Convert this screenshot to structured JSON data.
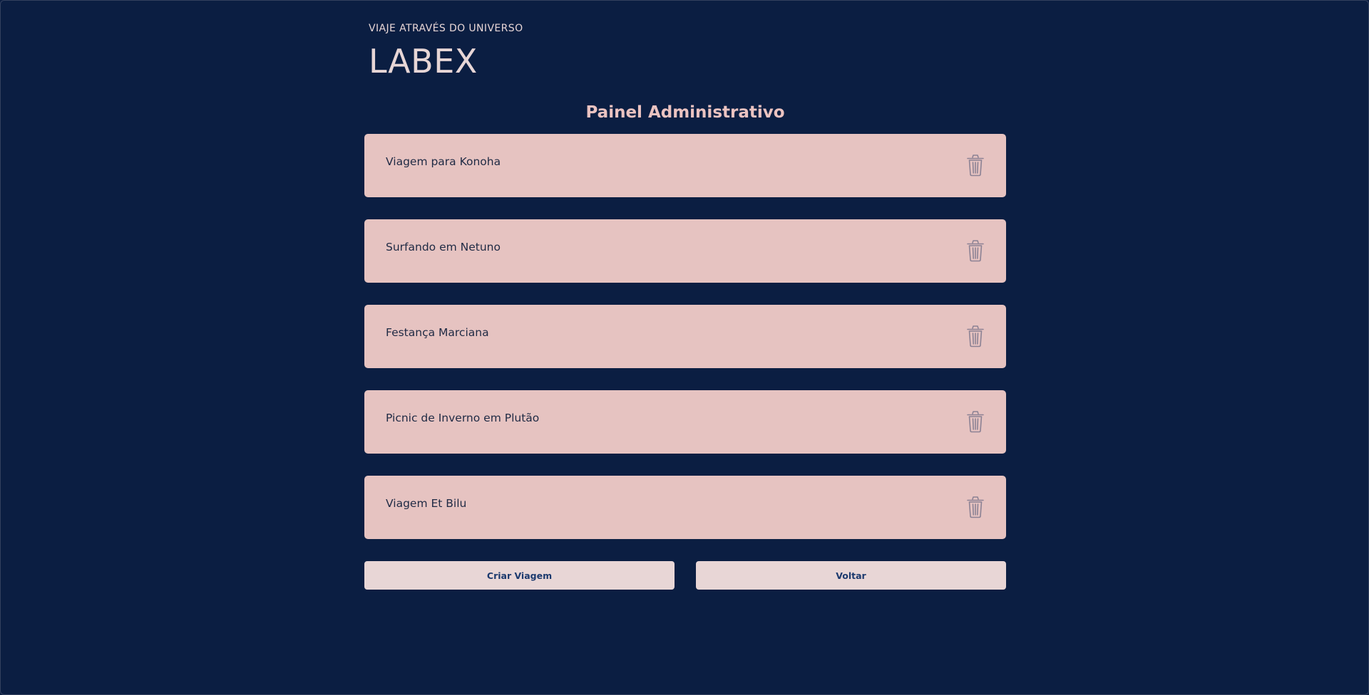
{
  "header": {
    "tagline": "VIAJE ATRAVÉS DO UNIVERSO",
    "logo": "LABEX"
  },
  "main": {
    "title": "Painel Administrativo",
    "trips": [
      {
        "name": "Viagem para Konoha",
        "icon": "trash-icon"
      },
      {
        "name": "Surfando em Netuno",
        "icon": "trash-icon"
      },
      {
        "name": "Festança Marciana",
        "icon": "trash-icon"
      },
      {
        "name": "Picnic de Inverno em Plutão",
        "icon": "trash-icon"
      },
      {
        "name": "Viagem Et Bilu",
        "icon": "trash-icon"
      }
    ],
    "actions": {
      "create_label": "Criar Viagem",
      "back_label": "Voltar"
    }
  },
  "colors": {
    "background": "#0b1e42",
    "card": "#e6c3c1",
    "title": "#ebc3c1",
    "button_bg": "#e8d6d6",
    "button_text": "#1c3a6e"
  }
}
